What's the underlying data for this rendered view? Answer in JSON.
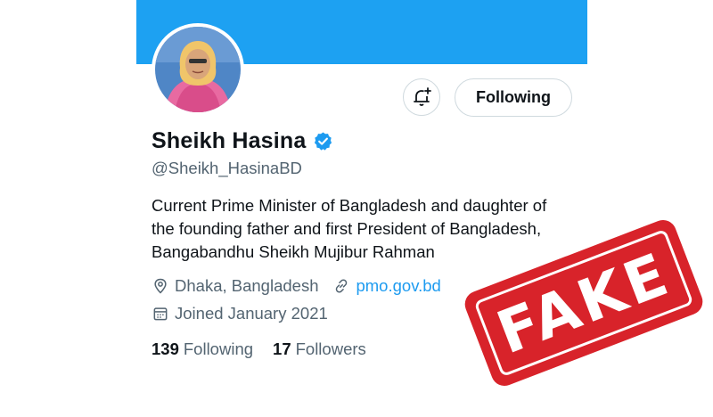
{
  "profile": {
    "name": "Sheikh Hasina",
    "handle": "@Sheikh_HasinaBD",
    "bio": "Current Prime Minister of Bangladesh and daughter of the founding father and first President of Bangladesh, Bangabandhu Sheikh Mujibur Rahman",
    "location": "Dhaka, Bangladesh",
    "website": "pmo.gov.bd",
    "joined": "Joined January 2021",
    "following_count": "139",
    "following_label": "Following",
    "followers_count": "17",
    "followers_label": "Followers"
  },
  "actions": {
    "follow_button_label": "Following",
    "notification_icon": "bell-plus-icon"
  },
  "stamp": {
    "text": "FAKE",
    "color": "#d8232a"
  },
  "colors": {
    "banner": "#1da1f2",
    "link": "#1d9bf0",
    "muted": "#536471",
    "verified": "#1d9bf0"
  }
}
